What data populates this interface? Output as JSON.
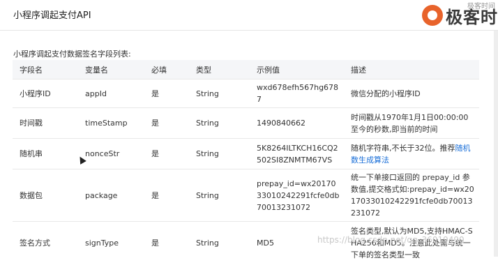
{
  "header": {
    "title": "小程序调起支付API"
  },
  "watermark": {
    "logo_text": "极客时",
    "logo_sub": "极客时间"
  },
  "section": {
    "label": "小程序调起支付数据签名字段列表:"
  },
  "table": {
    "columns": [
      "字段名",
      "变量名",
      "必填",
      "类型",
      "示例值",
      "描述"
    ],
    "rows": [
      {
        "name": "小程序ID",
        "var": "appId",
        "required": "是",
        "type": "String",
        "example": "wxd678efh567hg6787",
        "desc": "微信分配的小程序ID",
        "desc_link": ""
      },
      {
        "name": "时间戳",
        "var": "timeStamp",
        "required": "是",
        "type": "String",
        "example": "1490840662",
        "desc": "时间戳从1970年1月1日00:00:00至今的秒数,即当前的时间",
        "desc_link": ""
      },
      {
        "name": "随机串",
        "var": "nonceStr",
        "required": "是",
        "type": "String",
        "example": "5K8264ILTKCH16CQ2502SI8ZNMTM67VS",
        "desc": "随机字符串,不长于32位。推荐",
        "desc_link": "随机数生成算法"
      },
      {
        "name": "数据包",
        "var": "package",
        "required": "是",
        "type": "String",
        "example": "prepay_id=wx2017033010242291fcfe0db70013231072",
        "desc": "统一下单接口返回的 prepay_id 参数值,提交格式如:prepay_id=wx2017033010242291fcfe0db70013231072",
        "desc_link": ""
      },
      {
        "name": "签名方式",
        "var": "signType",
        "required": "是",
        "type": "String",
        "example": "MD5",
        "desc": "签名类型,默认为MD5,支持HMAC-SHA256和MD5。注意此处需与统一下单的签名类型一致",
        "desc_link": ""
      }
    ]
  },
  "footer": {
    "url": "https://blog.csdn.net/qq_36019490"
  }
}
